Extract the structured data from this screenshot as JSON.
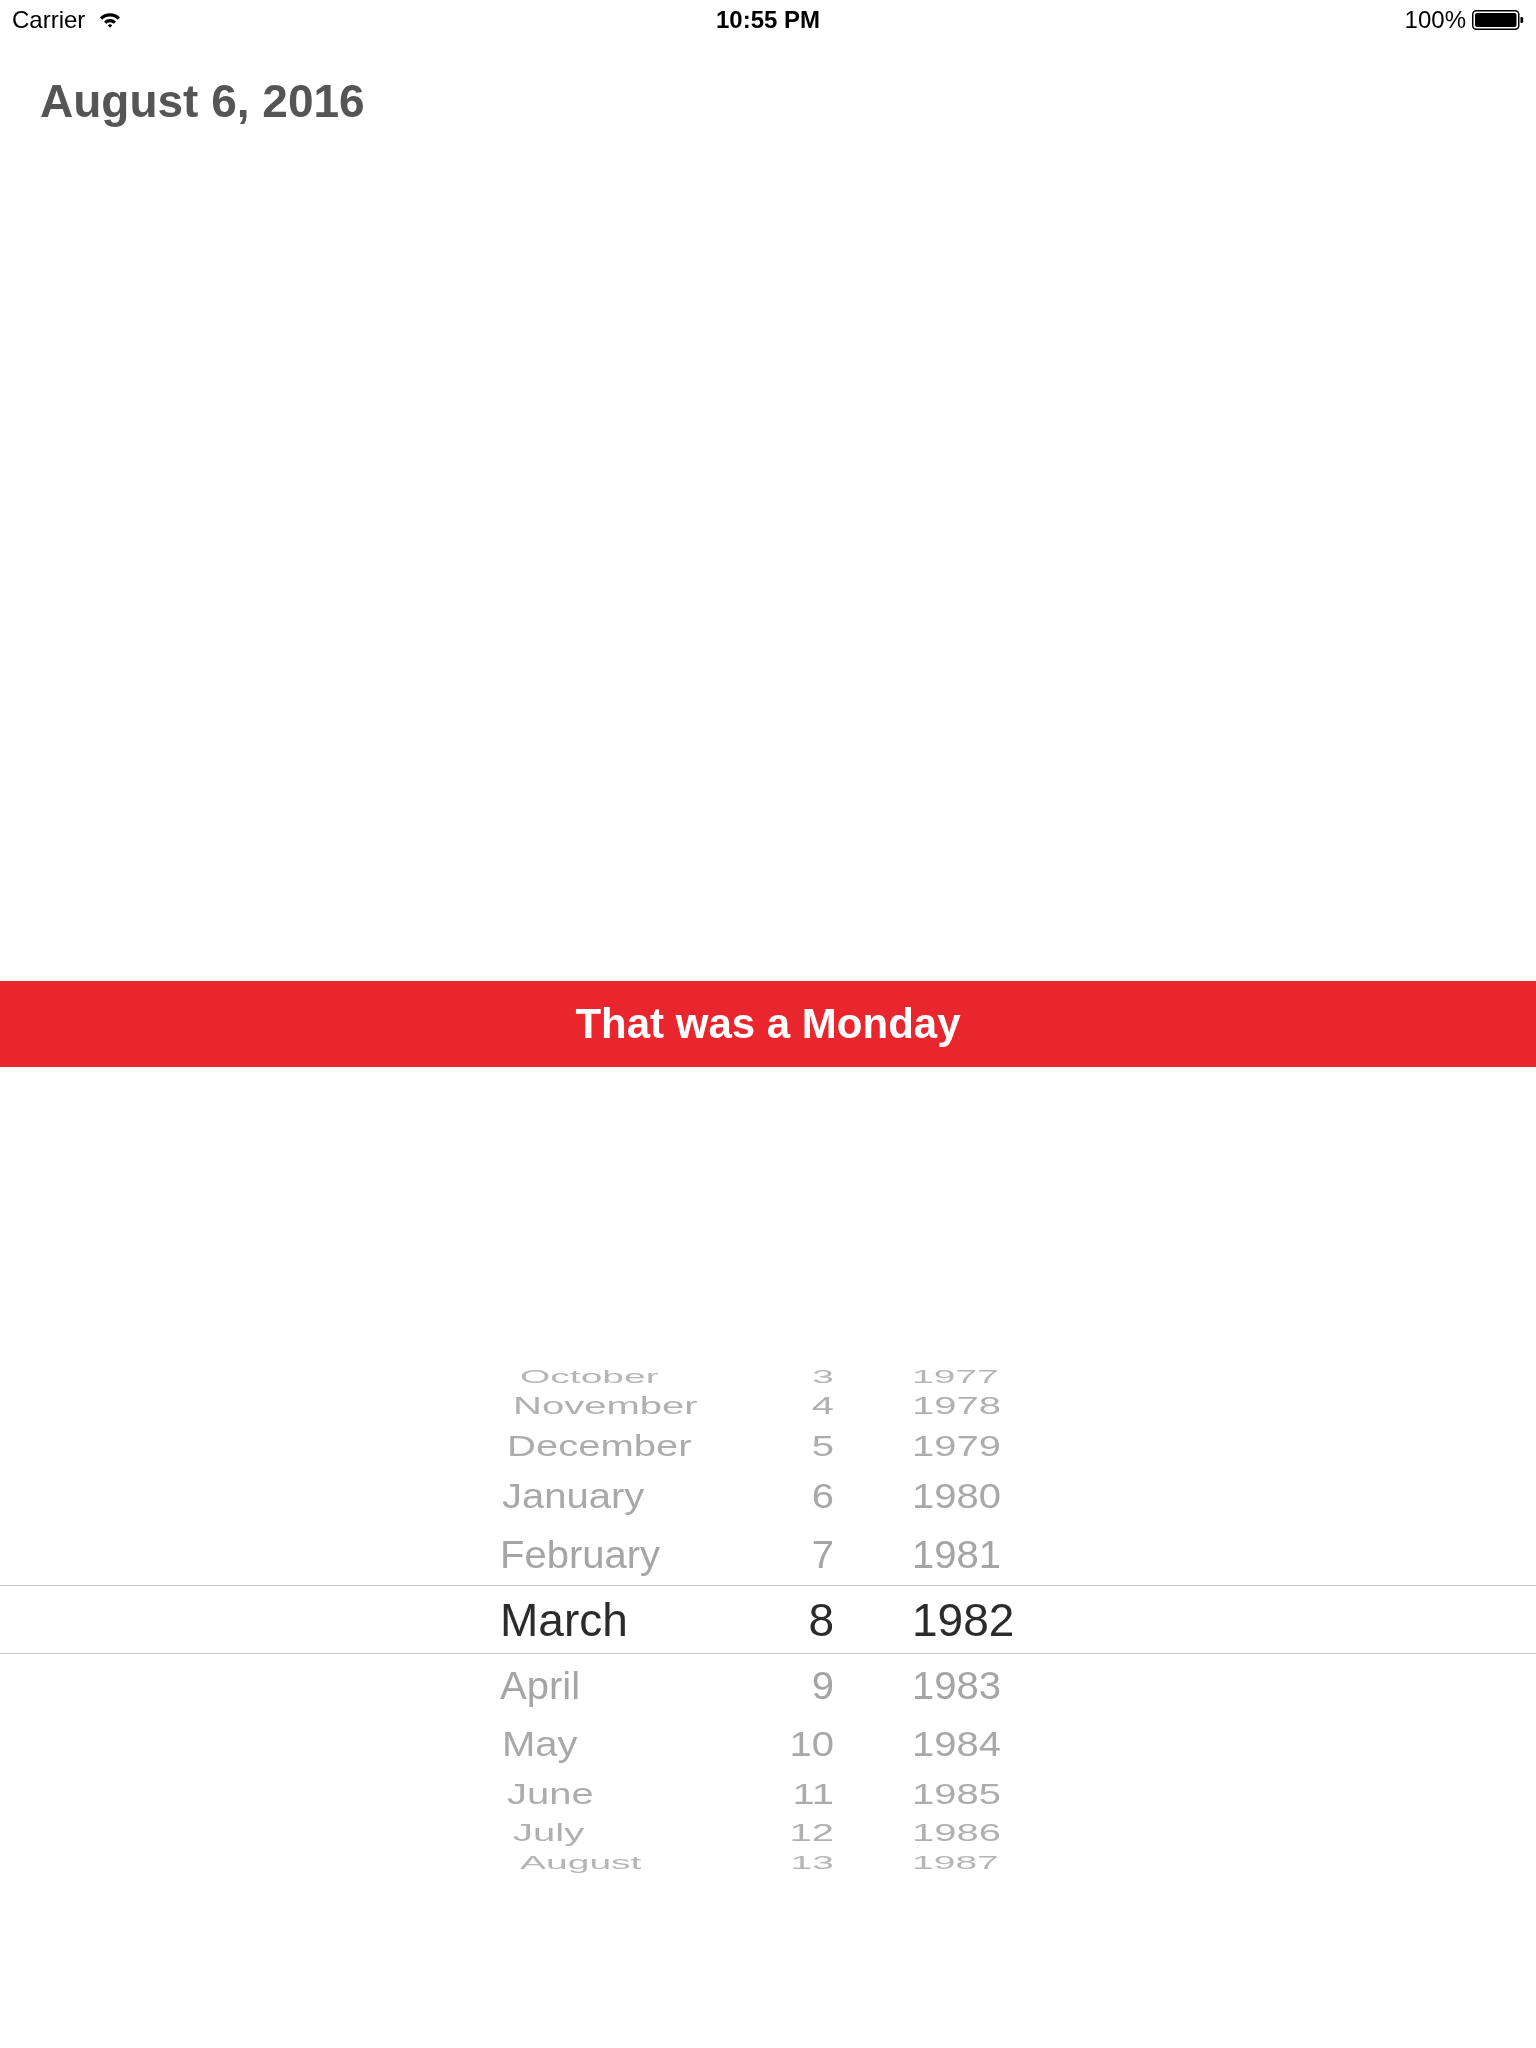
{
  "status_bar": {
    "carrier": "Carrier",
    "time": "10:55 PM",
    "battery": "100%"
  },
  "heading": "August 6, 2016",
  "banner": {
    "text": "That was a Monday"
  },
  "picker": {
    "columns": [
      {
        "kind": "month",
        "items": [
          {
            "label": "October",
            "selected": false
          },
          {
            "label": "November",
            "selected": false
          },
          {
            "label": "December",
            "selected": false
          },
          {
            "label": "January",
            "selected": false
          },
          {
            "label": "February",
            "selected": false
          },
          {
            "label": "March",
            "selected": true
          },
          {
            "label": "April",
            "selected": false
          },
          {
            "label": "May",
            "selected": false
          },
          {
            "label": "June",
            "selected": false
          },
          {
            "label": "July",
            "selected": false
          },
          {
            "label": "August",
            "selected": false
          }
        ]
      },
      {
        "kind": "day",
        "items": [
          {
            "label": "3",
            "selected": false
          },
          {
            "label": "4",
            "selected": false
          },
          {
            "label": "5",
            "selected": false
          },
          {
            "label": "6",
            "selected": false
          },
          {
            "label": "7",
            "selected": false
          },
          {
            "label": "8",
            "selected": true
          },
          {
            "label": "9",
            "selected": false
          },
          {
            "label": "10",
            "selected": false
          },
          {
            "label": "11",
            "selected": false
          },
          {
            "label": "12",
            "selected": false
          },
          {
            "label": "13",
            "selected": false
          }
        ]
      },
      {
        "kind": "year",
        "items": [
          {
            "label": "1977",
            "selected": false
          },
          {
            "label": "1978",
            "selected": false
          },
          {
            "label": "1979",
            "selected": false
          },
          {
            "label": "1980",
            "selected": false
          },
          {
            "label": "1981",
            "selected": false
          },
          {
            "label": "1982",
            "selected": true
          },
          {
            "label": "1983",
            "selected": false
          },
          {
            "label": "1984",
            "selected": false
          },
          {
            "label": "1985",
            "selected": false
          },
          {
            "label": "1986",
            "selected": false
          },
          {
            "label": "1987",
            "selected": false
          }
        ]
      }
    ]
  }
}
